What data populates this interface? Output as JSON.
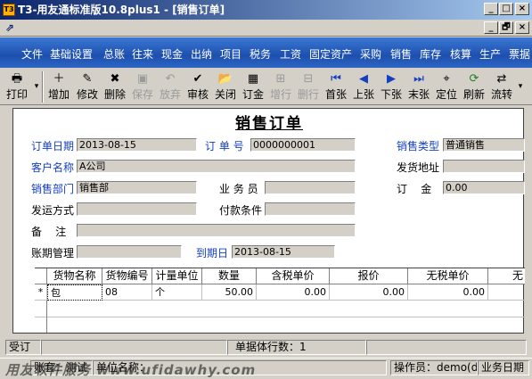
{
  "window": {
    "title": "T3-用友通标准版10.8plus1 - [销售订单]",
    "app_icon": "T3"
  },
  "window_buttons": [
    "_",
    "□",
    "×"
  ],
  "mdi_buttons": [
    "_",
    "🗗",
    "×"
  ],
  "menu": [
    "文件",
    "基础设置",
    "总账",
    "往来",
    "现金",
    "出纳",
    "项目",
    "税务",
    "工资",
    "固定资产",
    "采购",
    "销售",
    "库存",
    "核算",
    "生产",
    "票据"
  ],
  "toolbar": [
    {
      "label": "打印",
      "icon": "printer-icon",
      "glyph": "🖶",
      "enabled": true
    },
    {
      "label": "增加",
      "icon": "add-icon",
      "glyph": "＋",
      "enabled": true
    },
    {
      "label": "修改",
      "icon": "edit-icon",
      "glyph": "✎",
      "enabled": true
    },
    {
      "label": "删除",
      "icon": "delete-icon",
      "glyph": "✖",
      "enabled": true
    },
    {
      "label": "保存",
      "icon": "save-icon",
      "glyph": "▣",
      "enabled": false
    },
    {
      "label": "放弃",
      "icon": "undo-icon",
      "glyph": "↶",
      "enabled": false
    },
    {
      "label": "审核",
      "icon": "audit-icon",
      "glyph": "✔",
      "enabled": true
    },
    {
      "label": "关闭",
      "icon": "close-folder-icon",
      "glyph": "📂",
      "enabled": true
    },
    {
      "label": "订金",
      "icon": "deposit-icon",
      "glyph": "▦",
      "enabled": true
    },
    {
      "label": "增行",
      "icon": "add-row-icon",
      "glyph": "⊞",
      "enabled": false
    },
    {
      "label": "删行",
      "icon": "delete-row-icon",
      "glyph": "⊟",
      "enabled": false
    },
    {
      "label": "首张",
      "icon": "first-icon",
      "glyph": "⏮",
      "enabled": true
    },
    {
      "label": "上张",
      "icon": "prev-icon",
      "glyph": "◀",
      "enabled": true
    },
    {
      "label": "下张",
      "icon": "next-icon",
      "glyph": "▶",
      "enabled": true
    },
    {
      "label": "末张",
      "icon": "last-icon",
      "glyph": "⏭",
      "enabled": true
    },
    {
      "label": "定位",
      "icon": "locate-icon",
      "glyph": "⌖",
      "enabled": true
    },
    {
      "label": "刷新",
      "icon": "refresh-icon",
      "glyph": "⟳",
      "enabled": true
    },
    {
      "label": "流转",
      "icon": "flow-icon",
      "glyph": "⇄",
      "enabled": true
    }
  ],
  "form": {
    "title": "销售订单",
    "order_date_label": "订单日期",
    "order_date": "2013-08-15",
    "order_no_label": "订 单 号",
    "order_no": "0000000001",
    "sales_type_label": "销售类型",
    "sales_type": "普通销售",
    "customer_label": "客户名称",
    "customer": "A公司",
    "ship_addr_label": "发货地址",
    "dept_label": "销售部门",
    "dept": "销售部",
    "salesman_label": "业 务 员",
    "deposit_label": "订    金",
    "deposit": "0.00",
    "ship_method_label": "发运方式",
    "pay_terms_label": "付款条件",
    "remark_label": "备    注",
    "account_mgmt_label": "账期管理",
    "due_date_label": "到期日",
    "due_date": "2013-08-15"
  },
  "grid": {
    "columns": [
      "货物名称",
      "货物编号",
      "计量单位",
      "数量",
      "含税单价",
      "报价",
      "无税单价",
      "无"
    ],
    "row_marker": "*",
    "rows": [
      [
        "包",
        "08",
        "个",
        "50.00",
        "0.00",
        "0.00",
        "0.00",
        ""
      ]
    ]
  },
  "status": {
    "state": "受订",
    "row_count": "单据体行数：1",
    "user_panel": "账套：测试",
    "unit_panel": "单位名称：",
    "operator": "操作员：demo(de",
    "biz_date": "业务日期"
  },
  "watermark": "用友软件服务 www.ufidawhy.com"
}
